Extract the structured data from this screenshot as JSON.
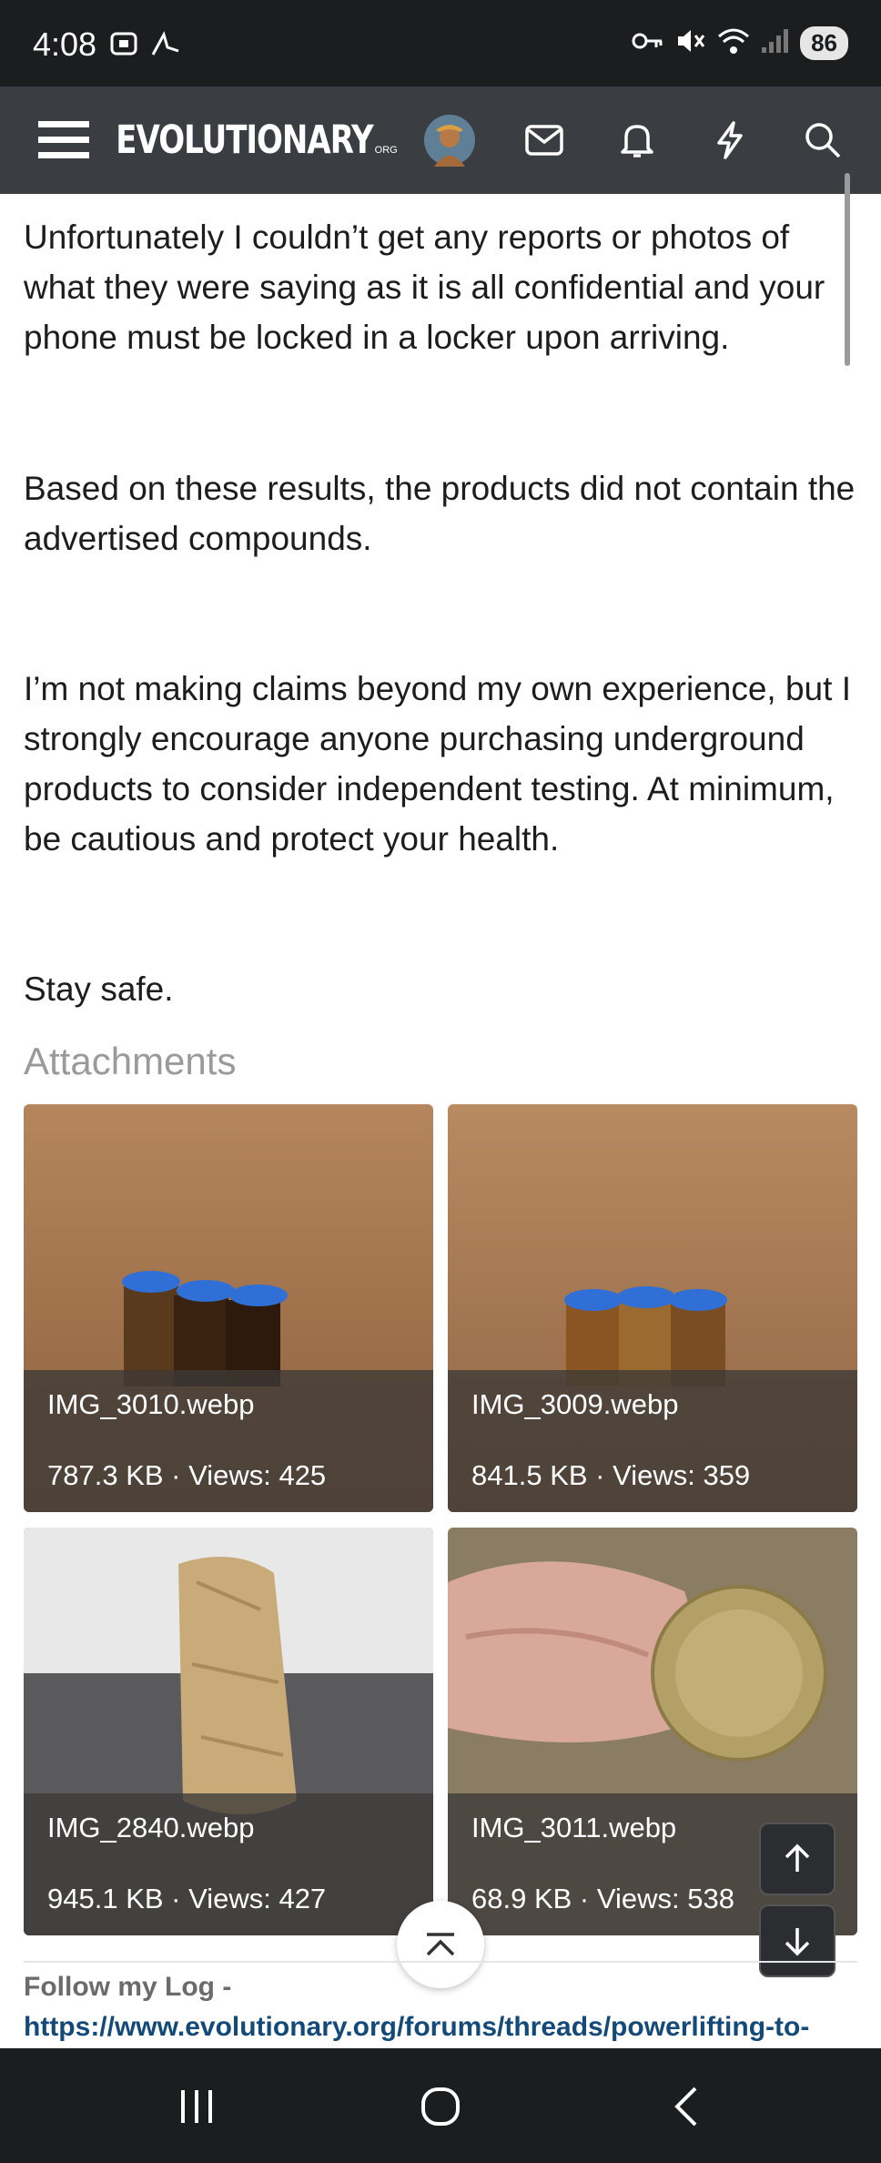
{
  "status_bar": {
    "time": "4:08",
    "battery": "86"
  },
  "nav": {
    "logo_text": "EVOLUTIONARY",
    "logo_suffix": "ORG"
  },
  "post": {
    "paragraphs": [
      "Unfortunately I couldn’t get any reports or photos of what they were saying as it is all confidential and your phone must be locked in a locker upon arriving.",
      "Based on these results, the products did not contain the advertised compounds.",
      "I’m not making claims beyond my own experience, but I strongly encourage anyone purchasing underground products to consider independent testing. At minimum, be cautious and protect your health.",
      "Stay safe."
    ]
  },
  "attachments": {
    "title": "Attachments",
    "items": [
      {
        "name": "IMG_3010.webp",
        "meta": "787.3 KB · Views: 425"
      },
      {
        "name": "IMG_3009.webp",
        "meta": "841.5 KB · Views: 359"
      },
      {
        "name": "IMG_2840.webp",
        "meta": "945.1 KB · Views: 427"
      },
      {
        "name": "IMG_3011.webp",
        "meta": "68.9 KB · Views: 538"
      }
    ]
  },
  "signature": {
    "label": "Follow my Log -",
    "link": "https://www.evolutionary.org/forums/threads/powerlifting-to-"
  },
  "colors": {
    "status_bg": "#1c1d1f",
    "nav_bg": "#3a3d42",
    "link": "#134a7a"
  }
}
